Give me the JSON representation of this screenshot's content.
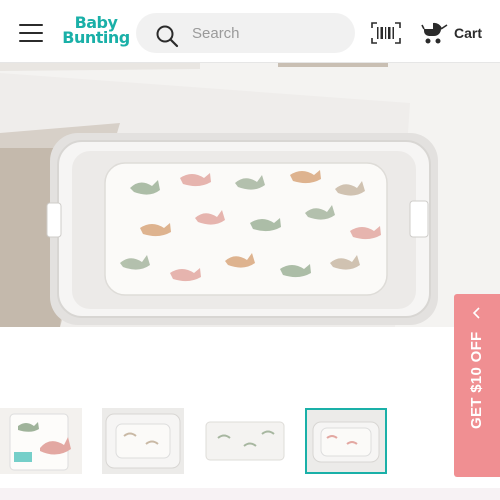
{
  "header": {
    "logo_line1": "Baby",
    "logo_line2": "Bunting",
    "search_placeholder": "Search",
    "cart_label": "Cart"
  },
  "icons": [
    "menu-icon",
    "search-icon",
    "barcode-scan-icon",
    "pram-cart-icon",
    "chevron-left-icon"
  ],
  "promo": {
    "label": "GET $10 OFF",
    "color": "#f08f92"
  },
  "gallery": {
    "image_count": 4,
    "active_index": 3
  },
  "colors": {
    "brand": "#1ab0a8",
    "promo": "#f08f92"
  }
}
